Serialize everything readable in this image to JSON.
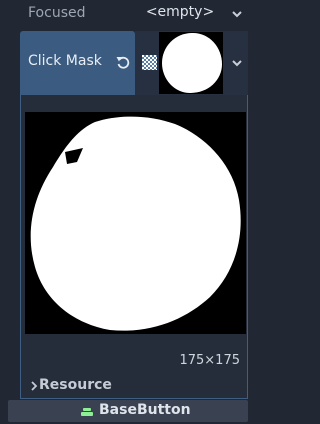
{
  "focused_row": {
    "label": "Focused",
    "value": "<empty>"
  },
  "click_mask_row": {
    "label": "Click Mask"
  },
  "editor": {
    "size_text": "175×175",
    "section_label": "Resource"
  },
  "footer": {
    "class_label": "BaseButton"
  },
  "colors": {
    "panel_bg": "#212733",
    "selected_label_bg": "#3b5b80",
    "editor_border": "#3f5e83",
    "footer_bg": "#3a4252",
    "base_icon": "#8eef97"
  }
}
